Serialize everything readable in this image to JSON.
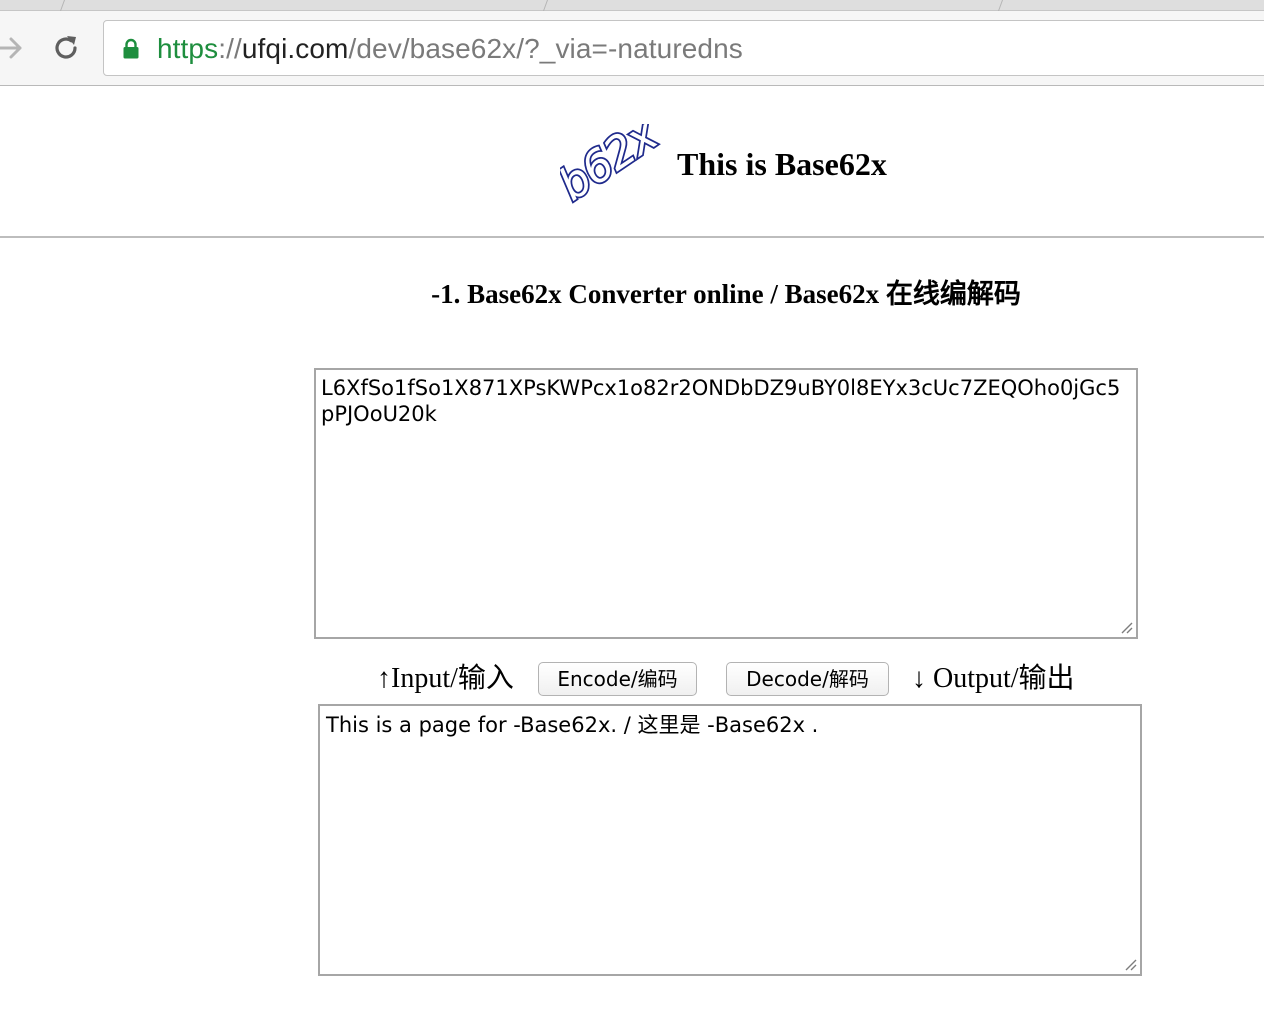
{
  "browser": {
    "url": {
      "scheme": "https",
      "separator": "://",
      "host": "ufqi.com",
      "path": "/dev/base62x/?_via=-naturedns"
    }
  },
  "header": {
    "logo_text": "b62x",
    "site_title": "This is Base62x"
  },
  "main": {
    "section_title": "-1. Base62x Converter online / Base62x 在线编解码",
    "input_value": "L6XfSo1fSo1X871XPsKWPcx1o82r2ONDbDZ9uBY0l8EYx3cUc7ZEQOho0jGc5pPJOoU20k",
    "input_label": "↑Input/输入",
    "encode_label": "Encode/编码",
    "decode_label": "Decode/解码",
    "output_label": "↓ Output/输出",
    "output_value": "This is a page for -Base62x. / 这里是 -Base62x ."
  },
  "colors": {
    "secure_green": "#1e8e3e",
    "logo_blue": "#1f2a8c"
  },
  "icons": [
    "forward-arrow-icon",
    "reload-icon",
    "lock-icon",
    "resize-grip-icon"
  ]
}
